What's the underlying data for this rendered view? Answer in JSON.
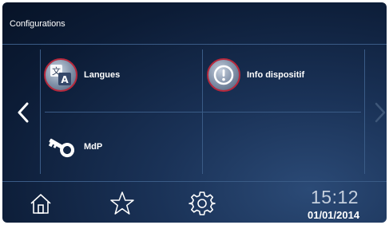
{
  "header": {
    "title": "Configurations"
  },
  "tiles": [
    {
      "label": "Langues",
      "icon": "language-icon"
    },
    {
      "label": "Info dispositif",
      "icon": "info-icon"
    },
    {
      "label": "MdP",
      "icon": "key-icon"
    }
  ],
  "navigation": {
    "left": "chevron-left-icon",
    "right": "chevron-right-icon"
  },
  "footer": {
    "buttons": [
      "home-icon",
      "star-icon",
      "gear-icon"
    ],
    "time": "15:12",
    "date": "01/01/2014"
  },
  "colors": {
    "accent_ring": "#b7283c",
    "grid_line": "#3a5b86",
    "background_dark": "#0c1c36"
  }
}
